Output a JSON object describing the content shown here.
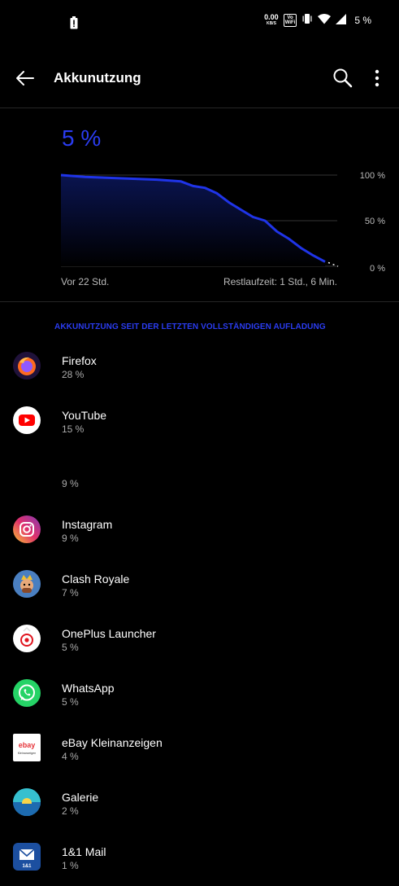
{
  "status_bar": {
    "speed_value": "0.00",
    "speed_unit": "KB/S",
    "volte_line1": "Vo",
    "volte_line2": "WiFi",
    "battery_pct": "5 %"
  },
  "header": {
    "title": "Akkunutzung"
  },
  "battery": {
    "current_pct": "5 %",
    "level_fraction": 0.05,
    "chart_left_label": "Vor 22 Std.",
    "chart_right_label": "Restlaufzeit: 1 Std., 6 Min.",
    "y_labels": [
      "100 %",
      "50 %",
      "0 %"
    ]
  },
  "chart_data": {
    "type": "area",
    "x_label_start": "Vor 22 Std.",
    "ylim": [
      0,
      100
    ],
    "y_ticks": [
      100,
      50,
      0
    ],
    "x_hours_ago": [
      22,
      20,
      18,
      16,
      14,
      12,
      11,
      10,
      9,
      8,
      7,
      6,
      5,
      4,
      3,
      2,
      1,
      0
    ],
    "values": [
      100,
      98,
      97,
      96,
      95,
      93,
      88,
      86,
      80,
      70,
      62,
      54,
      50,
      38,
      30,
      20,
      12,
      5
    ],
    "color": "#1f34e8"
  },
  "section": {
    "header": "AKKUNUTZUNG SEIT DER LETZTEN VOLLSTÄNDIGEN AUFLADUNG"
  },
  "apps": [
    {
      "name": "Firefox",
      "pct": "28 %",
      "icon": "firefox-icon"
    },
    {
      "name": "YouTube",
      "pct": "15 %",
      "icon": "youtube-icon"
    },
    {
      "name": "",
      "pct": "9 %",
      "icon": ""
    },
    {
      "name": "Instagram",
      "pct": "9 %",
      "icon": "instagram-icon"
    },
    {
      "name": "Clash Royale",
      "pct": "7 %",
      "icon": "clash-royale-icon"
    },
    {
      "name": "OnePlus Launcher",
      "pct": "5 %",
      "icon": "oneplus-launcher-icon"
    },
    {
      "name": "WhatsApp",
      "pct": "5 %",
      "icon": "whatsapp-icon"
    },
    {
      "name": "eBay Kleinanzeigen",
      "pct": "4 %",
      "icon": "ebay-kleinanzeigen-icon"
    },
    {
      "name": "Galerie",
      "pct": "2 %",
      "icon": "galerie-icon"
    },
    {
      "name": "1&1 Mail",
      "pct": "1 %",
      "icon": "mail-1und1-icon"
    }
  ],
  "ebay_logo_text": "ebay",
  "ebay_logo_sub": "Kleinanzeigen",
  "mail_logo_text": "1&1"
}
